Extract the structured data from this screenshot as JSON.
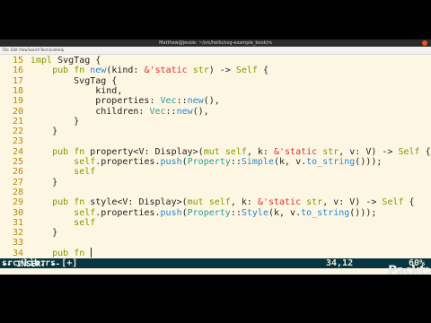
{
  "window": {
    "title": "Matthew@jessie: ~/src/hello/svg-example_book/rs"
  },
  "menubar": [
    "File",
    "Edit",
    "View",
    "Search",
    "Terminal",
    "Help"
  ],
  "editor": {
    "lines": [
      {
        "n": "15",
        "code": "impl SvgTag {"
      },
      {
        "n": "16",
        "code": "    pub fn new(kind: &'static str) -> Self {"
      },
      {
        "n": "17",
        "code": "        SvgTag {"
      },
      {
        "n": "18",
        "code": "            kind,"
      },
      {
        "n": "19",
        "code": "            properties: Vec::new(),"
      },
      {
        "n": "20",
        "code": "            children: Vec::new(),"
      },
      {
        "n": "21",
        "code": "        }"
      },
      {
        "n": "22",
        "code": "    }"
      },
      {
        "n": "23",
        "code": ""
      },
      {
        "n": "24",
        "code": "    pub fn property<V: Display>(mut self, k: &'static str, v: V) -> Self {"
      },
      {
        "n": "25",
        "code": "        self.properties.push(Property::Simple(k, v.to_string()));"
      },
      {
        "n": "26",
        "code": "        self"
      },
      {
        "n": "27",
        "code": "    }"
      },
      {
        "n": "28",
        "code": ""
      },
      {
        "n": "29",
        "code": "    pub fn style<V: Display>(mut self, k: &'static str, v: V) -> Self {"
      },
      {
        "n": "30",
        "code": "        self.properties.push(Property::Style(k, v.to_string()));"
      },
      {
        "n": "31",
        "code": "        self"
      },
      {
        "n": "32",
        "code": "    }"
      },
      {
        "n": "33",
        "code": ""
      },
      {
        "n": "34",
        "code": "    pub fn "
      }
    ]
  },
  "statusline": {
    "file": "src/lib.rs [+]",
    "position": "34,12",
    "percent": "60%"
  },
  "mode": "-- INSERT --",
  "logo": "Packt>"
}
